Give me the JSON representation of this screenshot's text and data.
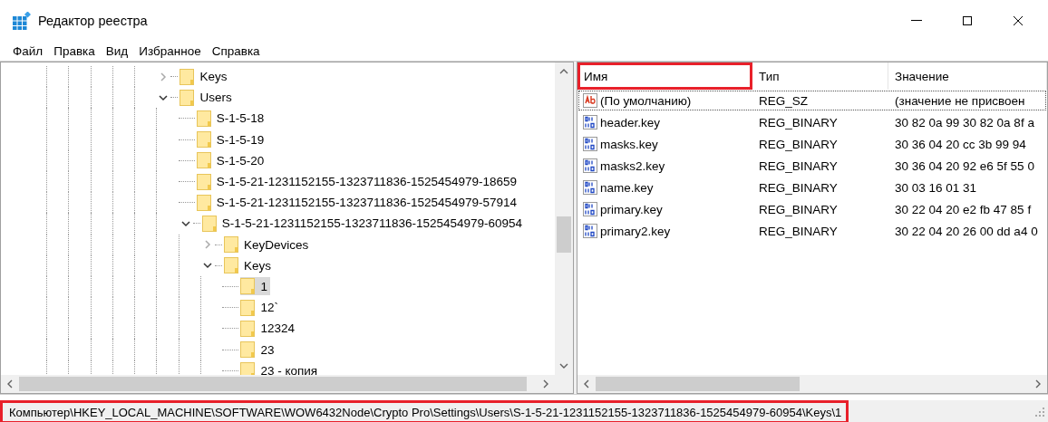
{
  "window": {
    "title": "Редактор реестра"
  },
  "menu": [
    "Файл",
    "Правка",
    "Вид",
    "Избранное",
    "Справка"
  ],
  "tree": [
    {
      "label": "Keys",
      "kind": "branch",
      "expanded": false,
      "selected": false
    },
    {
      "label": "Users",
      "kind": "branch",
      "expanded": true,
      "selected": false,
      "children": [
        {
          "label": "S-1-5-18",
          "kind": "leaf",
          "selected": false
        },
        {
          "label": "S-1-5-19",
          "kind": "leaf",
          "selected": false
        },
        {
          "label": "S-1-5-20",
          "kind": "leaf",
          "selected": false
        },
        {
          "label": "S-1-5-21-1231152155-1323711836-1525454979-18659",
          "kind": "leaf",
          "selected": false
        },
        {
          "label": "S-1-5-21-1231152155-1323711836-1525454979-57914",
          "kind": "leaf",
          "selected": false
        },
        {
          "label": "S-1-5-21-1231152155-1323711836-1525454979-60954",
          "kind": "branch",
          "expanded": true,
          "selected": false,
          "children": [
            {
              "label": "KeyDevices",
              "kind": "branch",
              "expanded": false,
              "selected": false
            },
            {
              "label": "Keys",
              "kind": "branch",
              "expanded": true,
              "selected": false,
              "children": [
                {
                  "label": "1",
                  "kind": "leaf",
                  "selected": true
                },
                {
                  "label": "12`",
                  "kind": "leaf",
                  "selected": false
                },
                {
                  "label": "12324",
                  "kind": "leaf",
                  "selected": false
                },
                {
                  "label": "23",
                  "kind": "leaf",
                  "selected": false
                },
                {
                  "label": "23 - копия",
                  "kind": "leaf",
                  "selected": false
                }
              ]
            }
          ]
        }
      ]
    }
  ],
  "table": {
    "columns": [
      {
        "label": "Имя",
        "highlighted": true
      },
      {
        "label": "Тип",
        "highlighted": false
      },
      {
        "label": "Значение",
        "highlighted": false
      }
    ],
    "rows": [
      {
        "kind": "string",
        "name": "(По умолчанию)",
        "type": "REG_SZ",
        "value": "(значение не присвоен",
        "focused": true
      },
      {
        "kind": "binary",
        "name": "header.key",
        "type": "REG_BINARY",
        "value": "30 82 0a 99 30 82 0a 8f a",
        "focused": false
      },
      {
        "kind": "binary",
        "name": "masks.key",
        "type": "REG_BINARY",
        "value": "30 36 04 20 cc 3b 99 94",
        "focused": false
      },
      {
        "kind": "binary",
        "name": "masks2.key",
        "type": "REG_BINARY",
        "value": "30 36 04 20 92 e6 5f 55 0",
        "focused": false
      },
      {
        "kind": "binary",
        "name": "name.key",
        "type": "REG_BINARY",
        "value": "30 03 16 01 31",
        "focused": false
      },
      {
        "kind": "binary",
        "name": "primary.key",
        "type": "REG_BINARY",
        "value": "30 22 04 20 e2 fb 47 85 f",
        "focused": false
      },
      {
        "kind": "binary",
        "name": "primary2.key",
        "type": "REG_BINARY",
        "value": "30 22 04 20 26 00 dd a4 0",
        "focused": false
      }
    ]
  },
  "status_bar": {
    "path": "Компьютер\\HKEY_LOCAL_MACHINE\\SOFTWARE\\WOW6432Node\\Crypto Pro\\Settings\\Users\\S-1-5-21-1231152155-1323711836-1525454979-60954\\Keys\\1",
    "highlighted": true
  }
}
